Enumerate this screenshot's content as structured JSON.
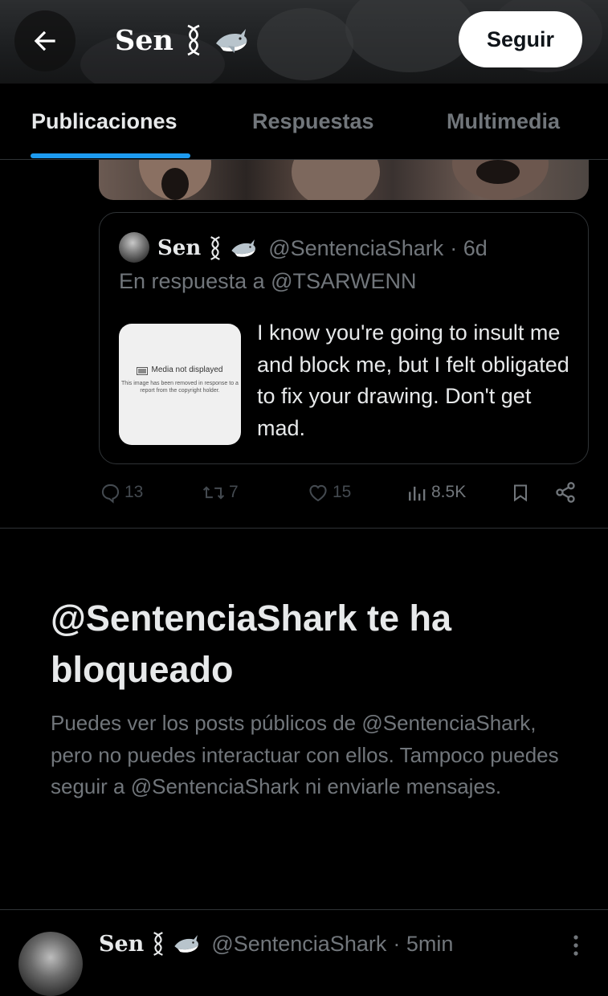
{
  "header": {
    "display_name": "Sen",
    "name_symbol": "∞",
    "shark_icon": "shark-icon",
    "follow_label": "Seguir",
    "back_icon": "arrow-left-icon"
  },
  "tabs": [
    {
      "label": "Publicaciones",
      "active": true
    },
    {
      "label": "Respuestas",
      "active": false
    },
    {
      "label": "Multimedia",
      "active": false
    }
  ],
  "quoted_post": {
    "author_name": "Sen",
    "author_handle": "@SentenciaShark",
    "time": "· 6d",
    "reply_to": "En respuesta a @TSARWENN",
    "media_notice_title": "Media not displayed",
    "media_notice_body": "This image has been removed in response to a report from the copyright holder.",
    "text": "I know you're going to insult me and block me, but I felt obligated to fix your drawing. Don't get mad."
  },
  "actions": {
    "replies": "13",
    "reposts": "7",
    "likes": "15",
    "views": "8.5K"
  },
  "blocked": {
    "title": "@SentenciaShark te ha bloqueado",
    "description": "Puedes ver los posts públicos de @SentenciaShark, pero no puedes interactuar con ellos. Tampoco puedes seguir a @SentenciaShark ni enviarle mensajes."
  },
  "next_post": {
    "author_name": "Sen",
    "author_handle": "@SentenciaShark",
    "time": "· 5min"
  },
  "colors": {
    "accent": "#1d9bf0",
    "background": "#000000",
    "text_primary": "#e7e9ea",
    "text_secondary": "#71767b",
    "border": "#2f3336"
  }
}
